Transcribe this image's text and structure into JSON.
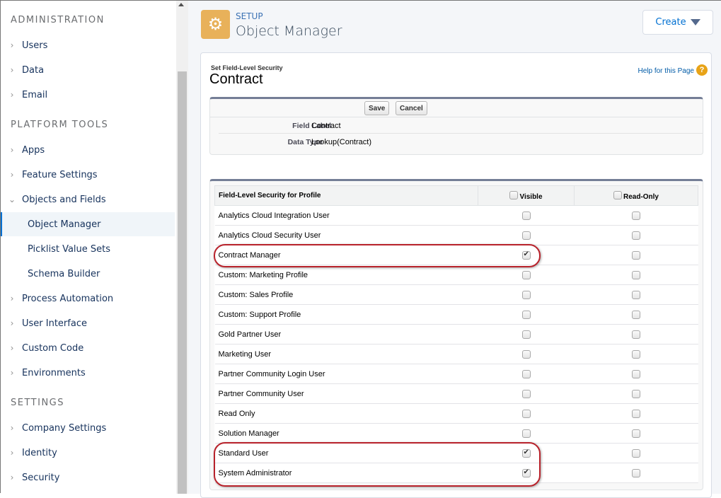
{
  "sidebar": {
    "sections": [
      {
        "title": "ADMINISTRATION",
        "items": [
          {
            "label": "Users",
            "chevron": "right"
          },
          {
            "label": "Data",
            "chevron": "right"
          },
          {
            "label": "Email",
            "chevron": "right"
          }
        ]
      },
      {
        "title": "PLATFORM TOOLS",
        "items": [
          {
            "label": "Apps",
            "chevron": "right"
          },
          {
            "label": "Feature Settings",
            "chevron": "right"
          },
          {
            "label": "Objects and Fields",
            "chevron": "down"
          },
          {
            "label": "Object Manager",
            "sub": true,
            "active": true
          },
          {
            "label": "Picklist Value Sets",
            "sub": true
          },
          {
            "label": "Schema Builder",
            "sub": true
          },
          {
            "label": "Process Automation",
            "chevron": "right"
          },
          {
            "label": "User Interface",
            "chevron": "right"
          },
          {
            "label": "Custom Code",
            "chevron": "right"
          },
          {
            "label": "Environments",
            "chevron": "right"
          }
        ]
      },
      {
        "title": "SETTINGS",
        "items": [
          {
            "label": "Company Settings",
            "chevron": "right"
          },
          {
            "label": "Identity",
            "chevron": "right"
          },
          {
            "label": "Security",
            "chevron": "right"
          }
        ]
      }
    ]
  },
  "header": {
    "icon": "gear-icon",
    "setup_label": "SETUP",
    "title": "Object Manager",
    "create_label": "Create"
  },
  "page": {
    "subtitle": "Set Field-Level Security",
    "title": "Contract",
    "help_label": "Help for this Page",
    "save_label": "Save",
    "cancel_label": "Cancel",
    "details": [
      {
        "label": "Field Label",
        "value": "Contract"
      },
      {
        "label": "Data Type",
        "value": "Lookup(Contract)"
      }
    ]
  },
  "fls": {
    "headers": {
      "profile": "Field-Level Security for Profile",
      "visible": "Visible",
      "readonly": "Read-Only"
    },
    "rows": [
      {
        "profile": "Analytics Cloud Integration User",
        "visible": false,
        "readonly": false
      },
      {
        "profile": "Analytics Cloud Security User",
        "visible": false,
        "readonly": false
      },
      {
        "profile": "Contract Manager",
        "visible": true,
        "readonly": false
      },
      {
        "profile": "Custom: Marketing Profile",
        "visible": false,
        "readonly": false
      },
      {
        "profile": "Custom: Sales Profile",
        "visible": false,
        "readonly": false
      },
      {
        "profile": "Custom: Support Profile",
        "visible": false,
        "readonly": false
      },
      {
        "profile": "Gold Partner User",
        "visible": false,
        "readonly": false
      },
      {
        "profile": "Marketing User",
        "visible": false,
        "readonly": false
      },
      {
        "profile": "Partner Community Login User",
        "visible": false,
        "readonly": false
      },
      {
        "profile": "Partner Community User",
        "visible": false,
        "readonly": false
      },
      {
        "profile": "Read Only",
        "visible": false,
        "readonly": false
      },
      {
        "profile": "Solution Manager",
        "visible": false,
        "readonly": false
      },
      {
        "profile": "Standard User",
        "visible": true,
        "readonly": false
      },
      {
        "profile": "System Administrator",
        "visible": true,
        "readonly": false
      }
    ]
  },
  "colors": {
    "accent": "#0070d2",
    "setup_icon": "#e8b15a",
    "annotation": "#b8222b"
  }
}
